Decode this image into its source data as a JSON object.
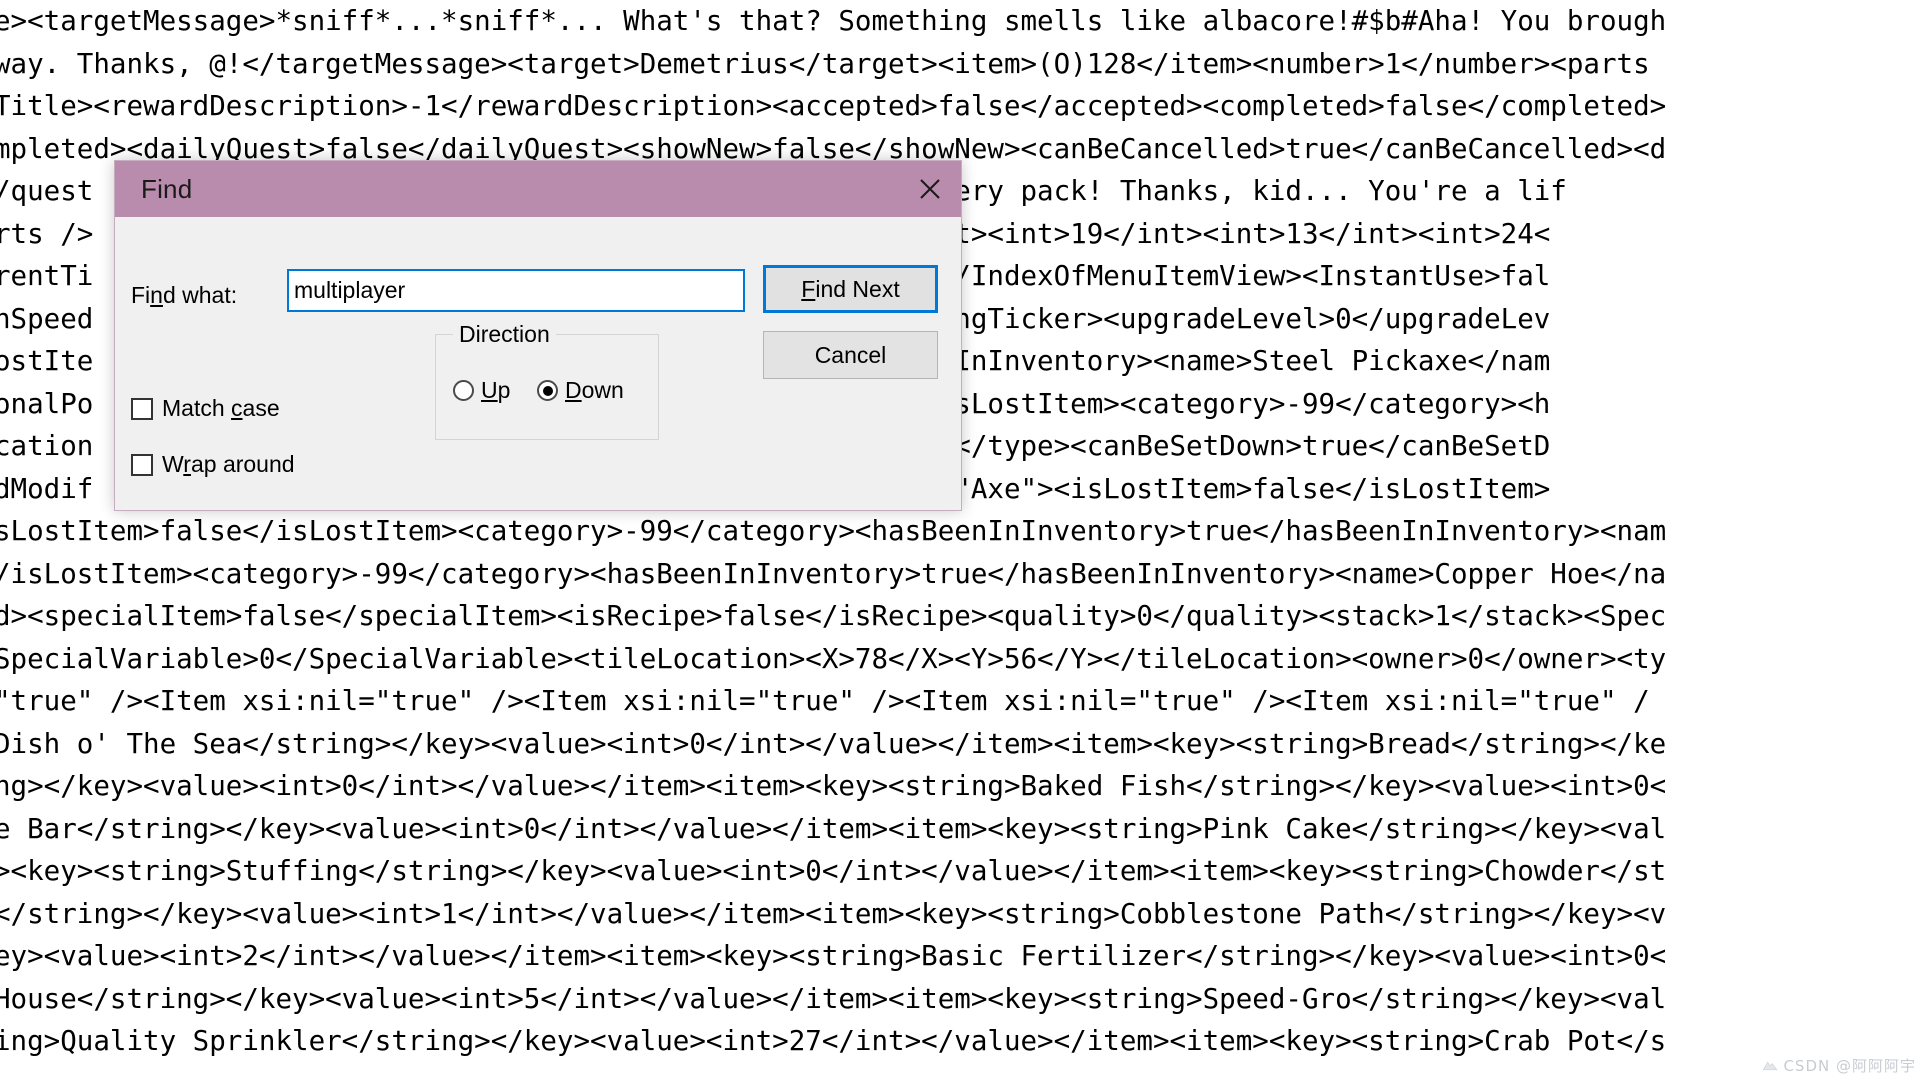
{
  "document": {
    "name": "notepad-text-area",
    "lines": [
      "e><targetMessage>*sniff*...*sniff*... What's that? Something smells like albacore!#$b#Aha! You brough",
      "way. Thanks, @!</targetMessage><target>Demetrius</target><item>(O)128</item><number>1</number><parts",
      "Title><rewardDescription>-1</rewardDescription><accepted>false</accepted><completed>false</completed>",
      "mpleted><dailyQuest>false</dailyQuest><showNew>false</showNew><canBeCancelled>true</canBeCancelled><d",
      "/quest                                       with the battery pack! Thanks, kid... You're a lif",
      "rts />                                     ions><int>0</int><int>19</int><int>13</int><int>24<",
      "rentTi                                     enuItemView>53</IndexOfMenuItemView><InstantUse>fal",
      "nSpeed                                     ker>765630</swingTicker><upgradeLevel>0</upgradeLev",
      "ostIte                                     y>true</hasBeenInInventory><name>Steel Pickaxe</nam",
      "onalPo                                     stItem>false</isLostItem><category>-99</category><h",
      "cation                                     her><type>Basic</type><canBeSetDown>true</canBeSetD",
      "dModif                                     <Item xsi:type=\"Axe\"><isLostItem>false</isLostItem>",
      "sLostItem>false</isLostItem><category>-99</category><hasBeenInInventory>true</hasBeenInInventory><nam",
      "/isLostItem><category>-99</category><hasBeenInInventory>true</hasBeenInInventory><name>Copper Hoe</na",
      "d><specialItem>false</specialItem><isRecipe>false</isRecipe><quality>0</quality><stack>1</stack><Spec",
      "SpecialVariable>0</SpecialVariable><tileLocation><X>78</X><Y>56</Y></tileLocation><owner>0</owner><ty",
      "\"true\" /><Item xsi:nil=\"true\" /><Item xsi:nil=\"true\" /><Item xsi:nil=\"true\" /><Item xsi:nil=\"true\" /",
      "Dish o' The Sea</string></key><value><int>0</int></value></item><item><key><string>Bread</string></ke",
      "ng></key><value><int>0</int></value></item><item><key><string>Baked Fish</string></key><value><int>0<",
      "e Bar</string></key><value><int>0</int></value></item><item><key><string>Pink Cake</string></key><val",
      "><key><string>Stuffing</string></key><value><int>0</int></value></item><item><key><string>Chowder</st",
      "</string></key><value><int>1</int></value></item><item><key><string>Cobblestone Path</string></key><v",
      "ey><value><int>2</int></value></item><item><key><string>Basic Fertilizer</string></key><value><int>0<",
      "House</string></key><value><int>5</int></value></item><item><key><string>Speed-Gro</string></key><val",
      "ing>Quality Sprinkler</string></key><value><int>27</int></value></item><item><key><string>Crab Pot</s"
    ]
  },
  "dialog": {
    "title": "Find",
    "close_icon": "close-icon",
    "find_what_label_pre": "Fi",
    "find_what_label_accel": "n",
    "find_what_label_post": "d what:",
    "find_what_value": "multiplayer",
    "find_what_placeholder": "",
    "buttons": {
      "find_next_pre": "",
      "find_next_accel": "F",
      "find_next_post": "ind Next",
      "cancel": "Cancel"
    },
    "direction": {
      "legend": "Direction",
      "options": [
        {
          "label_accel": "U",
          "label_post": "p",
          "checked": false
        },
        {
          "label_accel": "D",
          "label_post": "own",
          "checked": true
        }
      ],
      "selected": "Down"
    },
    "checkboxes": [
      {
        "label_pre": "Match ",
        "label_accel": "c",
        "label_post": "ase",
        "checked": false
      },
      {
        "label_pre": "W",
        "label_accel": "r",
        "label_post": "ap around",
        "checked": false
      }
    ],
    "colors": {
      "titlebar": "#b98bac",
      "dialog_face": "#f0f0f0",
      "focus_accent": "#0078d7",
      "button_face": "#e1e1e1"
    }
  },
  "watermark": {
    "text": "CSDN @阿阿阿宇"
  }
}
